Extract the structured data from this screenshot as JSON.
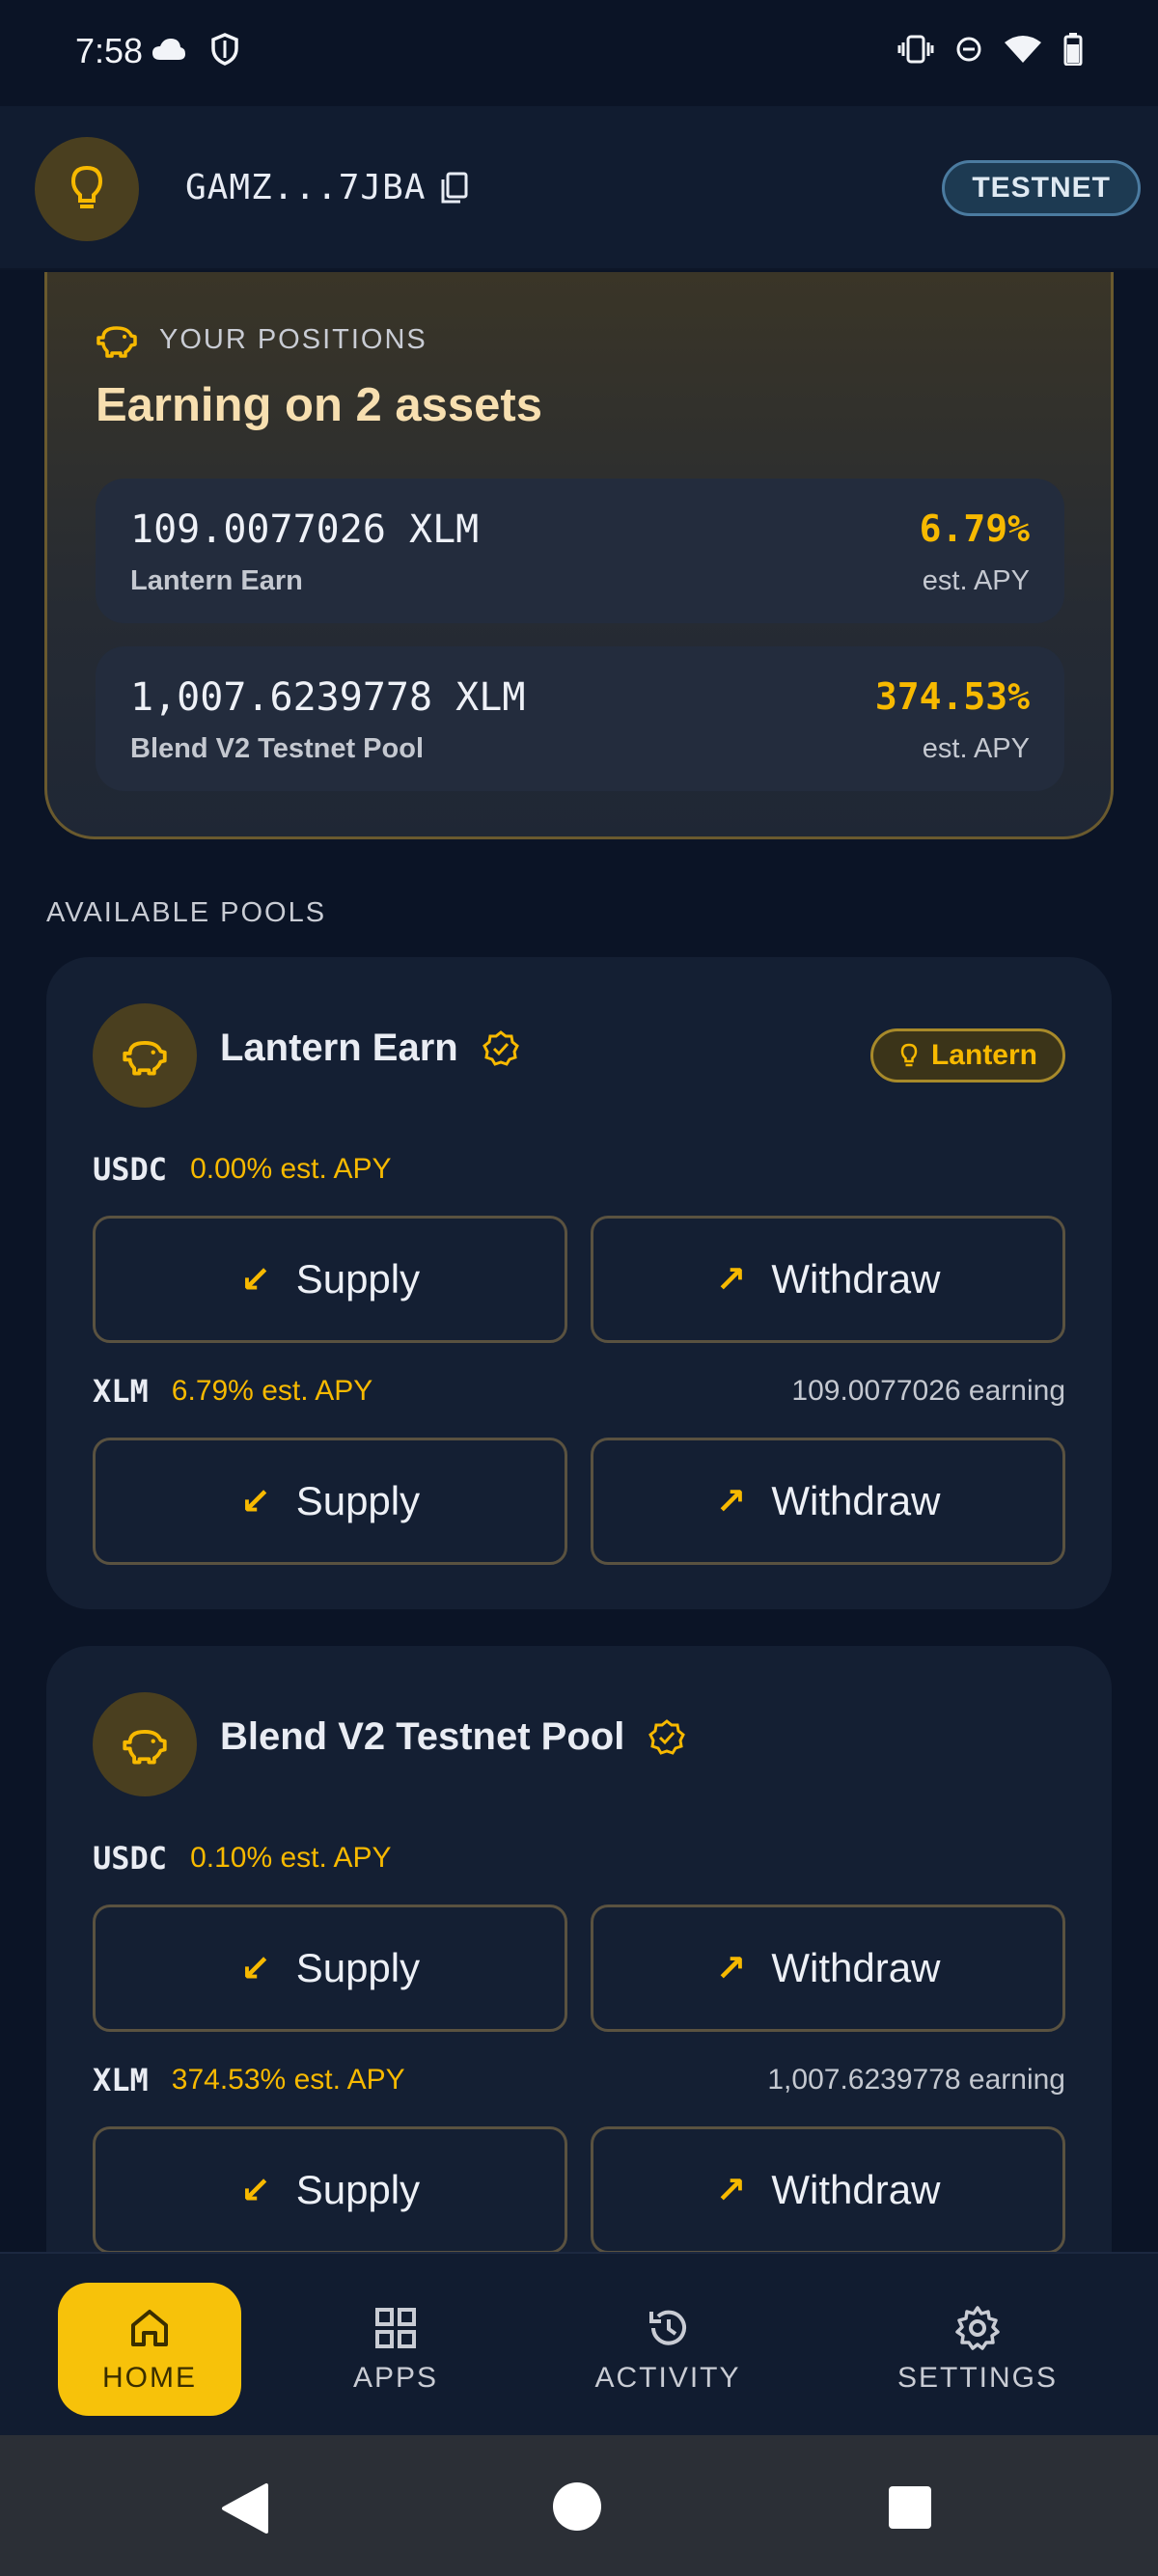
{
  "status_bar": {
    "time": "7:58",
    "icons_left": [
      "cloud-icon",
      "shield-icon"
    ],
    "icons_right": [
      "vibrate-icon",
      "dnd-icon",
      "wifi-icon",
      "battery-icon"
    ]
  },
  "header": {
    "address": "GAMZ...7JBA",
    "network_badge": "TESTNET"
  },
  "positions": {
    "label": "YOUR POSITIONS",
    "title": "Earning on 2 assets",
    "items": [
      {
        "amount": "109.0077026 XLM",
        "pool": "Lantern Earn",
        "apy": "6.79%",
        "apy_label": "est. APY"
      },
      {
        "amount": "1,007.6239778 XLM",
        "pool": "Blend V2 Testnet Pool",
        "apy": "374.53%",
        "apy_label": "est. APY"
      }
    ]
  },
  "available_pools_label": "AVAILABLE POOLS",
  "pools": [
    {
      "name": "Lantern Earn",
      "badge": "Lantern",
      "assets": [
        {
          "symbol": "USDC",
          "apy": "0.00% est. APY",
          "earning": ""
        },
        {
          "symbol": "XLM",
          "apy": "6.79% est. APY",
          "earning": "109.0077026 earning"
        }
      ]
    },
    {
      "name": "Blend V2 Testnet Pool",
      "badge": "",
      "assets": [
        {
          "symbol": "USDC",
          "apy": "0.10% est. APY",
          "earning": ""
        },
        {
          "symbol": "XLM",
          "apy": "374.53% est. APY",
          "earning": "1,007.6239778 earning"
        }
      ]
    }
  ],
  "actions": {
    "supply": "Supply",
    "withdraw": "Withdraw"
  },
  "nav": [
    {
      "label": "HOME",
      "icon": "home-icon",
      "active": true
    },
    {
      "label": "APPS",
      "icon": "grid-icon",
      "active": false
    },
    {
      "label": "ACTIVITY",
      "icon": "history-icon",
      "active": false
    },
    {
      "label": "SETTINGS",
      "icon": "gear-icon",
      "active": false
    }
  ],
  "colors": {
    "background": "#0b1426",
    "accent": "#f7b900",
    "card": "#141f33",
    "nav_active": "#f7c20a"
  }
}
